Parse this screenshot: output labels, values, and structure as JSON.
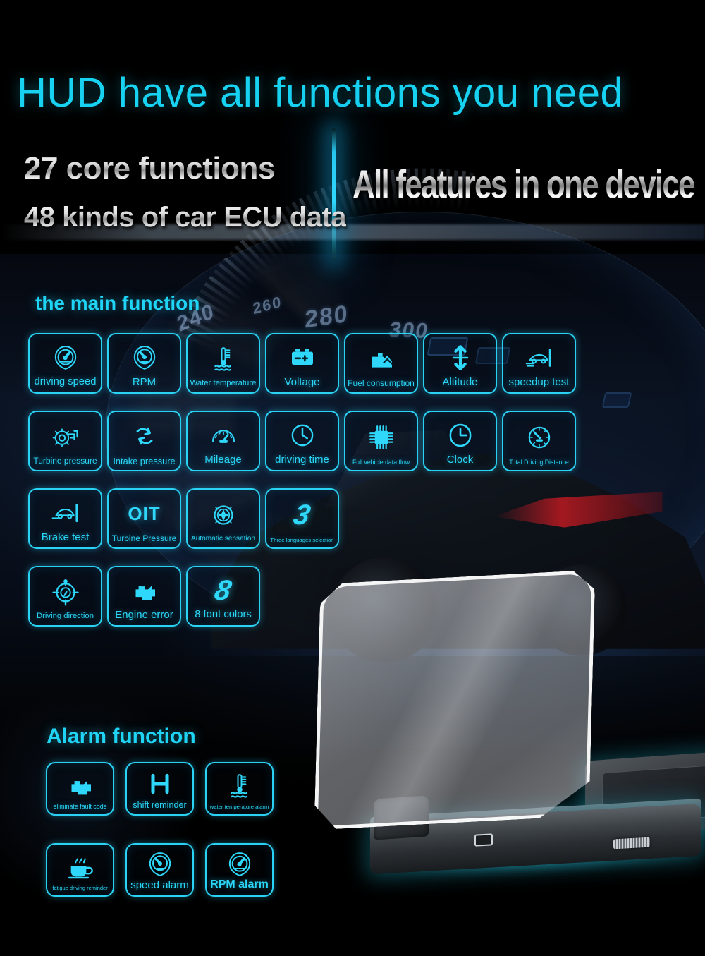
{
  "headline": {
    "main": "HUD have all functions you need",
    "sub_line1": "27 core functions",
    "sub_line2": "48 kinds of car ECU data",
    "right_slogan": "All features in one device"
  },
  "sections": {
    "main_function": {
      "title": "the main function",
      "tiles": [
        {
          "label": "driving speed",
          "icon": "speedometer-icon"
        },
        {
          "label": "RPM",
          "icon": "tachometer-icon"
        },
        {
          "label": "Water temperature",
          "icon": "coolant-temp-icon"
        },
        {
          "label": "Voltage",
          "icon": "battery-icon"
        },
        {
          "label": "Fuel consumption",
          "icon": "fuel-can-icon"
        },
        {
          "label": "Altitude",
          "icon": "altitude-arrows-icon"
        },
        {
          "label": "speedup test",
          "icon": "car-accelerate-icon"
        },
        {
          "label": "Turbine pressure",
          "icon": "turbo-icon"
        },
        {
          "label": "Intake pressure",
          "icon": "intake-cycle-icon"
        },
        {
          "label": "Mileage",
          "icon": "odometer-icon"
        },
        {
          "label": "driving time",
          "icon": "clock-icon"
        },
        {
          "label": "Full vehicle data flow",
          "icon": "chip-icon"
        },
        {
          "label": "Clock",
          "icon": "wall-clock-icon"
        },
        {
          "label": "Total Driving Distance",
          "icon": "gauge-dial-icon"
        },
        {
          "label": "Brake test",
          "icon": "car-brake-icon"
        },
        {
          "label": "Turbine Pressure",
          "icon": "oit-text-icon",
          "icon_text": "OIT"
        },
        {
          "label": "Automatic sensation",
          "icon": "turbine-fan-icon"
        },
        {
          "label": "Three languages selection",
          "icon": "number-three-icon",
          "icon_text": "3"
        },
        {
          "label": "Driving direction",
          "icon": "compass-icon"
        },
        {
          "label": "Engine error",
          "icon": "check-engine-icon"
        },
        {
          "label": "8 font colors",
          "icon": "number-eight-icon",
          "icon_text": "8"
        }
      ]
    },
    "alarm_function": {
      "title": "Alarm function",
      "tiles": [
        {
          "label": "eliminate fault code",
          "icon": "check-engine-icon"
        },
        {
          "label": "shift reminder",
          "icon": "gear-shift-icon"
        },
        {
          "label": "water temperature alarm",
          "icon": "coolant-temp-icon"
        },
        {
          "label": "fatigue driving reminder",
          "icon": "coffee-cup-icon"
        },
        {
          "label": "speed alarm",
          "icon": "tachometer-icon"
        },
        {
          "label": "RPM alarm",
          "icon": "speedometer-icon"
        }
      ]
    }
  },
  "background": {
    "speedometer_numbers": [
      "240",
      "260",
      "280",
      "300"
    ]
  },
  "colors": {
    "accent_cyan": "#2ad6f7",
    "heading_cyan": "#18d2f2",
    "background": "#000000",
    "navy": "#0e1a2e",
    "silver_text": "#e6e6e6"
  },
  "device": {
    "parts": [
      "combiner-glass",
      "hinge",
      "base",
      "mini-usb-port",
      "adjust-dial",
      "display-module"
    ]
  }
}
